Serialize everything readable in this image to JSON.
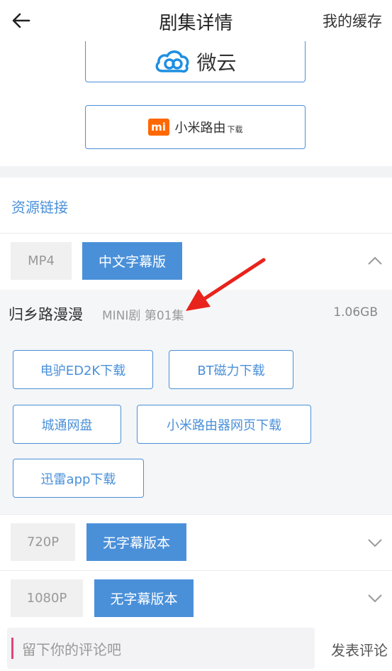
{
  "header": {
    "title": "剧集详情",
    "right_label": "我的缓存"
  },
  "share_buttons": {
    "weiyun_label": "微云",
    "xiaomi_label": "小米路由",
    "xiaomi_sub": "下载"
  },
  "section": {
    "title": "资源链接"
  },
  "formats": [
    {
      "tag": "MP4",
      "version": "中文字幕版",
      "expanded": true
    },
    {
      "tag": "720P",
      "version": "无字幕版本",
      "expanded": false
    },
    {
      "tag": "1080P",
      "version": "无字幕版本",
      "expanded": false
    }
  ],
  "episode": {
    "title": "归乡路漫漫",
    "subtitle": "MINI剧 第01集",
    "size": "1.06GB"
  },
  "download_buttons": [
    "电驴ED2K下载",
    "BT磁力下载",
    "城通网盘",
    "小米路由器网页下载",
    "迅雷app下载"
  ],
  "comment": {
    "placeholder": "留下你的评论吧",
    "submit_label": "发表评论"
  },
  "colors": {
    "accent": "#4a90d9",
    "annotation": "#e8231c",
    "xiaomi_orange": "#ff6700"
  }
}
